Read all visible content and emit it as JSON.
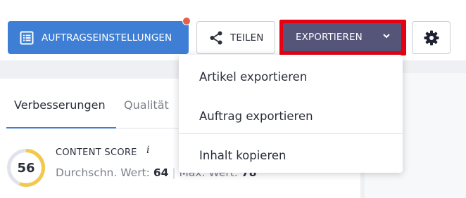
{
  "toolbar": {
    "job_settings_label": "AUFTRAGSEINSTELLUNGEN",
    "share_label": "TEILEN",
    "export_label": "EXPORTIEREN",
    "colors": {
      "primary": "#3e7fd5",
      "export": "#555579",
      "highlight": "#e60012",
      "notification": "#e5604c"
    },
    "icons": {
      "job_settings": "list-document-icon",
      "share": "share-icon",
      "export": "chevron-down-icon",
      "settings": "gear-icon"
    }
  },
  "export_menu": {
    "items": [
      {
        "label": "Artikel exportieren"
      },
      {
        "label": "Auftrag exportieren"
      },
      {
        "label": "Inhalt kopieren"
      }
    ]
  },
  "tabs": [
    {
      "label": "Verbesserungen",
      "active": true
    },
    {
      "label": "Qualität",
      "active": false
    }
  ],
  "content_score": {
    "label": "CONTENT SCORE",
    "info": "i",
    "value": "56",
    "progress": 0.56,
    "avg_label": "Durchschn. Wert:",
    "avg_value": "64",
    "separator": "|",
    "max_label": "Max. Wert:",
    "max_value": "78",
    "colors": {
      "ring_fill": "#f2c94c",
      "ring_track": "#e1e3ea"
    }
  }
}
